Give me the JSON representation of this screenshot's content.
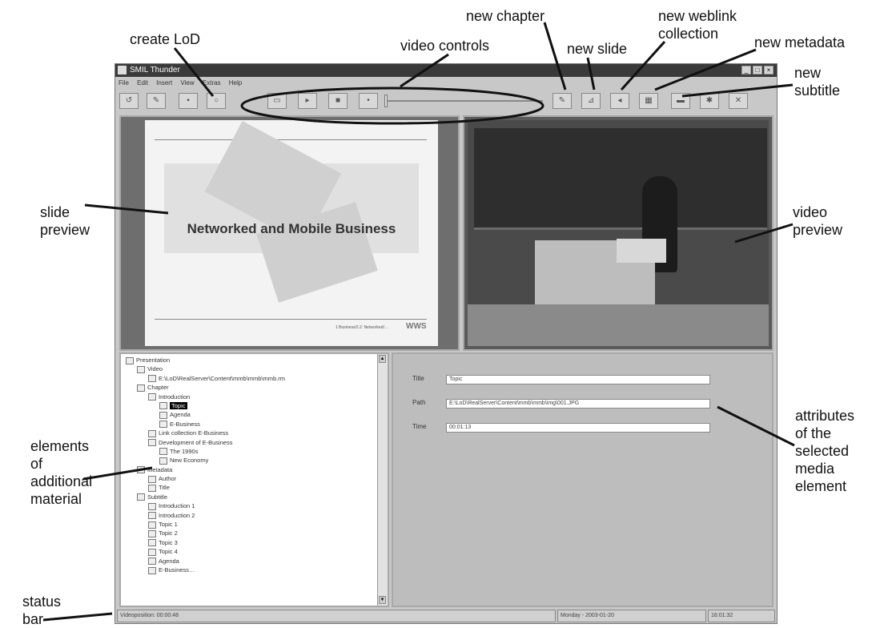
{
  "annotations": {
    "create_lod": "create LoD",
    "video_controls": "video controls",
    "new_chapter": "new chapter",
    "new_slide": "new slide",
    "new_weblink_collection": "new weblink collection",
    "new_metadata": "new metadata",
    "new_subtitle": "new subtitle",
    "slide_preview": "slide preview",
    "video_preview": "video preview",
    "elements_of_additional_material": "elements of additional material",
    "attributes_of_selected": "attributes of the selected media element",
    "status_bar": "status bar"
  },
  "window": {
    "title": "SMIL Thunder",
    "menu": [
      "File",
      "Edit",
      "Insert",
      "View",
      "Extras",
      "Help"
    ]
  },
  "slide": {
    "title": "Networked and Mobile Business",
    "footer": "1 Business/2.2: Networked/…",
    "logo": "WWS"
  },
  "tree": {
    "items": [
      {
        "label": "Presentation",
        "level": 0
      },
      {
        "label": "Video",
        "level": 1
      },
      {
        "label": "E:\\LoD\\RealServer\\Content\\mmb\\mmb\\mmb.rm",
        "level": 2
      },
      {
        "label": "Chapter",
        "level": 1
      },
      {
        "label": "Introduction",
        "level": 2
      },
      {
        "label": "Topic",
        "level": 3,
        "selected": true
      },
      {
        "label": "Agenda",
        "level": 3
      },
      {
        "label": "E-Business",
        "level": 3
      },
      {
        "label": "Link collection E-Business",
        "level": 2
      },
      {
        "label": "Development of E-Business",
        "level": 2
      },
      {
        "label": "The 1990s",
        "level": 3
      },
      {
        "label": "New Economy",
        "level": 3
      },
      {
        "label": "Metadata",
        "level": 1
      },
      {
        "label": "Author",
        "level": 2
      },
      {
        "label": "Title",
        "level": 2
      },
      {
        "label": "Subtitle",
        "level": 1
      },
      {
        "label": "Introduction 1",
        "level": 2
      },
      {
        "label": "Introduction 2",
        "level": 2
      },
      {
        "label": "Topic 1",
        "level": 2
      },
      {
        "label": "Topic 2",
        "level": 2
      },
      {
        "label": "Topic 3",
        "level": 2
      },
      {
        "label": "Topic 4",
        "level": 2
      },
      {
        "label": "Agenda",
        "level": 2
      },
      {
        "label": "E-Business…",
        "level": 2
      }
    ]
  },
  "attributes": {
    "title_label": "Title",
    "title_value": "Topic",
    "path_label": "Path",
    "path_value": "E:\\LoD\\RealServer\\Content\\mmb\\mmb\\img\\001.JPG",
    "time_label": "Time",
    "time_value": "00:01:13"
  },
  "status": {
    "position": "Videoposition: 00:00:48",
    "date": "Monday - 2003-01-20",
    "time": "16:01:32"
  }
}
